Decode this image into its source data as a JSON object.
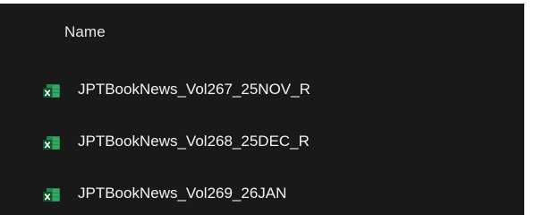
{
  "list": {
    "column_header": "Name",
    "files": [
      {
        "name": "JPTBookNews_Vol267_25NOV_R",
        "icon": "excel-file-icon"
      },
      {
        "name": "JPTBookNews_Vol268_25DEC_R",
        "icon": "excel-file-icon"
      },
      {
        "name": "JPTBookNews_Vol269_26JAN",
        "icon": "excel-file-icon"
      }
    ]
  },
  "colors": {
    "background": "#191919",
    "text": "#f2f2f2",
    "excel_green": "#1d7a43",
    "excel_dark_green": "#10542d"
  }
}
